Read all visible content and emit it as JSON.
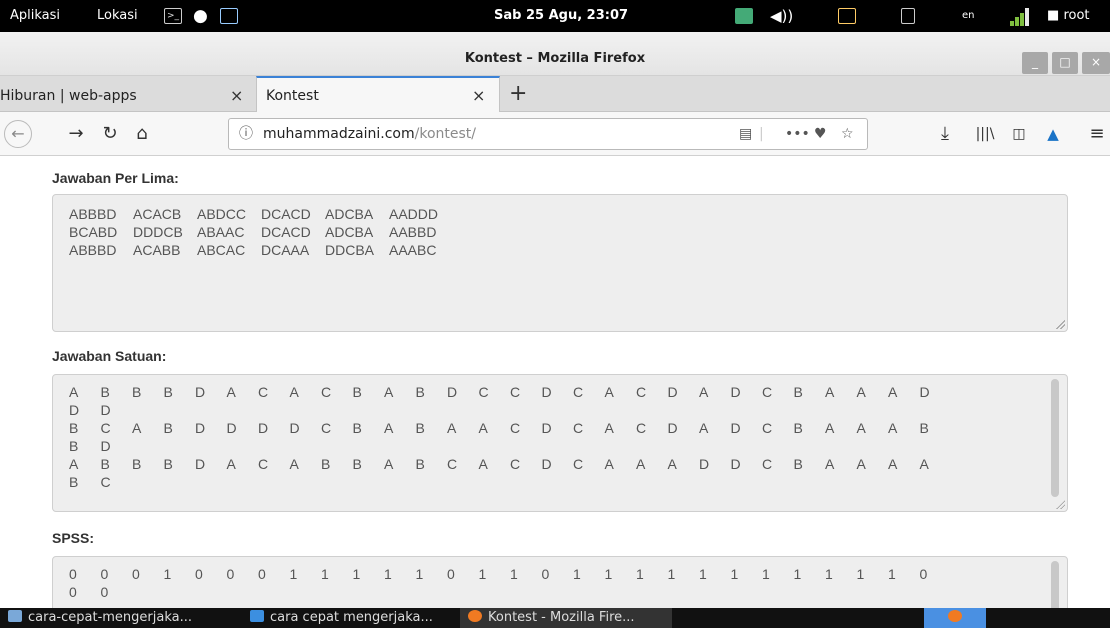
{
  "top_panel": {
    "menu_apps": "Aplikasi",
    "menu_places": "Lokasi",
    "clock": "Sab 25 Agu, 23:07",
    "keyboard_layout": "en",
    "user": "root"
  },
  "window": {
    "title": "Kontest – Mozilla Firefox"
  },
  "tabs": [
    {
      "label": "Hiburan | web-apps",
      "close": "×"
    },
    {
      "label": "Kontest",
      "close": "×"
    }
  ],
  "new_tab_label": "+",
  "address_bar": {
    "domain": "muhammadzaini.com",
    "path": "/kontest/",
    "more_label": "•••"
  },
  "sections": {
    "per_lima": {
      "label": "Jawaban Per Lima:",
      "lines": [
        [
          "ABBBD",
          "ACACB",
          "ABDCC",
          "DCACD",
          "ADCBA",
          "AADDD"
        ],
        [
          "BCABD",
          "DDDCB",
          "ABAAC",
          "DCACD",
          "ADCBA",
          "AABBD"
        ],
        [
          "ABBBD",
          "ACABB",
          "ABCAC",
          "DCAAA",
          "DDCBA",
          "AAABC"
        ]
      ]
    },
    "satuan": {
      "label": "Jawaban Satuan:",
      "lines": [
        [
          "A",
          "B",
          "B",
          "B",
          "D",
          "A",
          "C",
          "A",
          "C",
          "B",
          "A",
          "B",
          "D",
          "C",
          "C",
          "D",
          "C",
          "A",
          "C",
          "D",
          "A",
          "D",
          "C",
          "B",
          "A",
          "A",
          "A",
          "D"
        ],
        [
          "D",
          "D"
        ],
        [
          "B",
          "C",
          "A",
          "B",
          "D",
          "D",
          "D",
          "D",
          "C",
          "B",
          "A",
          "B",
          "A",
          "A",
          "C",
          "D",
          "C",
          "A",
          "C",
          "D",
          "A",
          "D",
          "C",
          "B",
          "A",
          "A",
          "A",
          "B"
        ],
        [
          "B",
          "D"
        ],
        [
          "A",
          "B",
          "B",
          "B",
          "D",
          "A",
          "C",
          "A",
          "B",
          "B",
          "A",
          "B",
          "C",
          "A",
          "C",
          "D",
          "C",
          "A",
          "A",
          "A",
          "D",
          "D",
          "C",
          "B",
          "A",
          "A",
          "A",
          "A"
        ],
        [
          "B",
          "C"
        ]
      ]
    },
    "spss": {
      "label": "SPSS:",
      "lines": [
        [
          "0",
          "0",
          "0",
          "1",
          "0",
          "0",
          "0",
          "1",
          "1",
          "1",
          "1",
          "1",
          "0",
          "1",
          "1",
          "0",
          "1",
          "1",
          "1",
          "1",
          "1",
          "1",
          "1",
          "1",
          "1",
          "1",
          "1",
          "0"
        ],
        [
          "0",
          "0"
        ]
      ]
    }
  },
  "taskbar": {
    "items": [
      {
        "label": "cara-cepat-mengerjaka..."
      },
      {
        "label": "cara cepat mengerjaka..."
      },
      {
        "label": "Kontest - Mozilla Fire..."
      }
    ]
  },
  "colors": {
    "accent": "#3b82d6",
    "textarea_bg": "#eeeeee",
    "text": "#555555"
  }
}
